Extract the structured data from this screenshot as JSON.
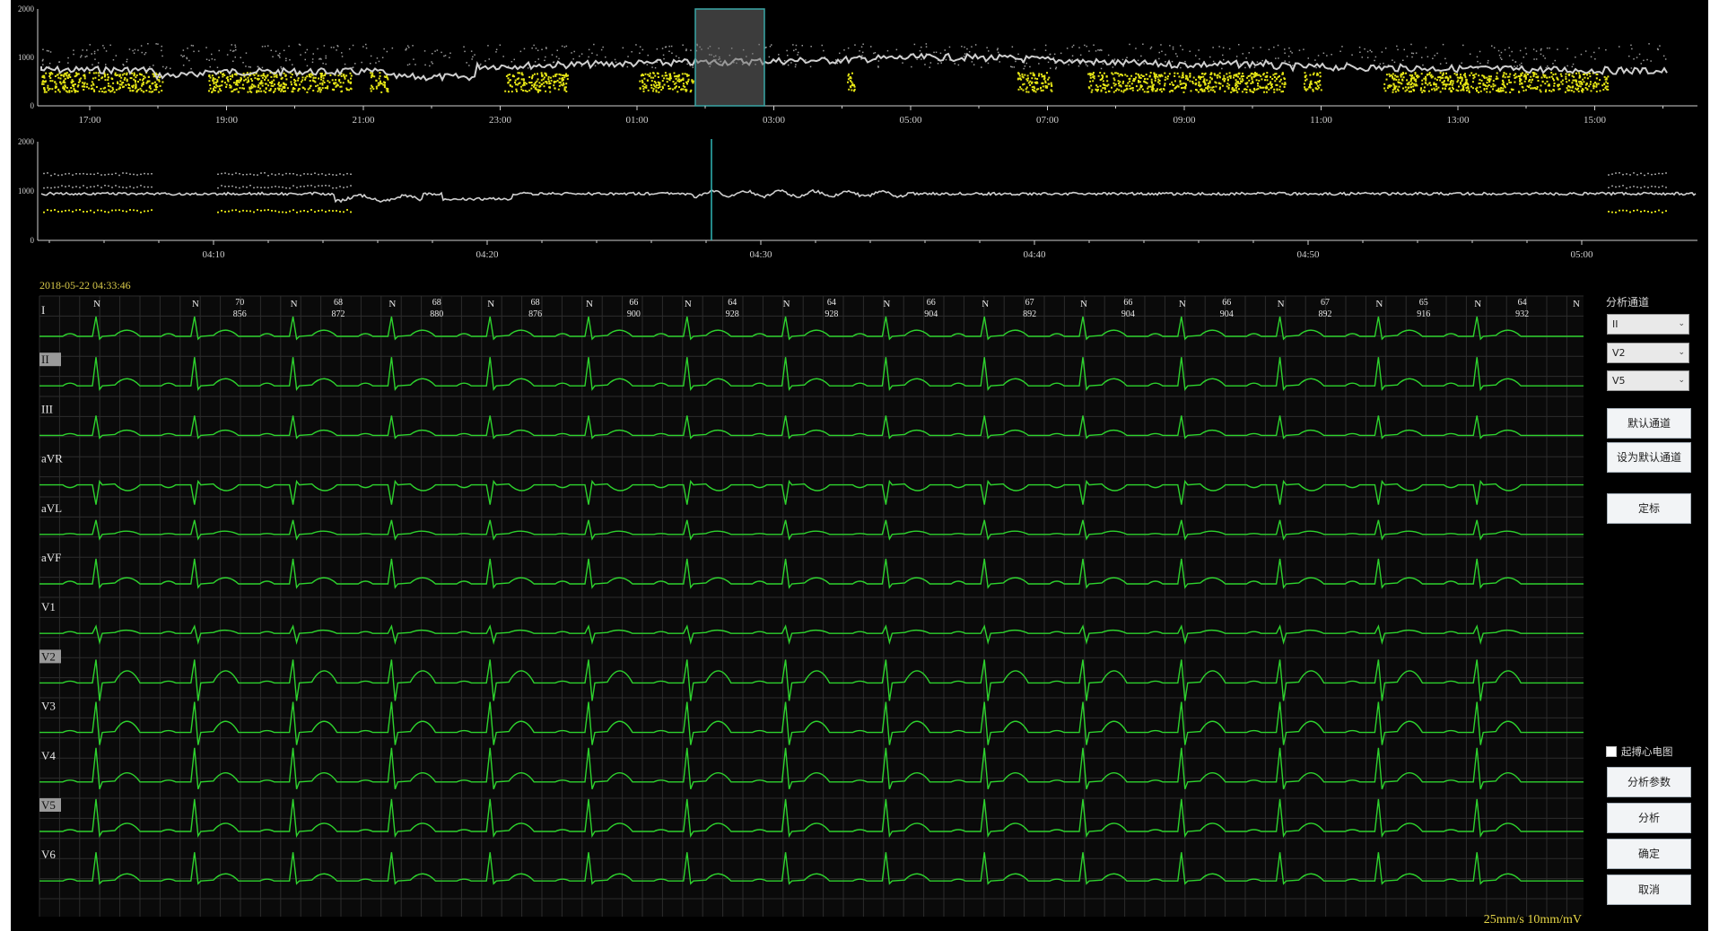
{
  "overview": {
    "y_axis": [
      "2000",
      "1000",
      "0"
    ],
    "time_ticks": [
      "17:00",
      "19:00",
      "21:00",
      "23:00",
      "01:00",
      "03:00",
      "05:00",
      "07:00",
      "09:00",
      "11:00",
      "13:00",
      "15:00"
    ]
  },
  "zoom": {
    "y_axis": [
      "2000",
      "1000",
      "0"
    ],
    "time_ticks": [
      "04:10",
      "04:20",
      "04:30",
      "04:40",
      "04:50",
      "05:00"
    ]
  },
  "ecg": {
    "timestamp": "2018-05-22 04:33:46",
    "leads": [
      "I",
      "II",
      "III",
      "aVR",
      "aVL",
      "aVF",
      "V1",
      "V2",
      "V3",
      "V4",
      "V5",
      "V6"
    ],
    "selected_leads": [
      "II",
      "V2",
      "V5"
    ],
    "beat_labels": [
      "N",
      "N",
      "N",
      "N",
      "N",
      "N",
      "N",
      "N",
      "N",
      "N",
      "N",
      "N",
      "N",
      "N",
      "N",
      "N"
    ],
    "hr_values": [
      "70",
      "68",
      "68",
      "68",
      "66",
      "64",
      "64",
      "66",
      "67",
      "66",
      "66",
      "67",
      "65",
      "64"
    ],
    "rr_values": [
      "856",
      "872",
      "880",
      "876",
      "900",
      "928",
      "928",
      "904",
      "892",
      "904",
      "904",
      "892",
      "916",
      "932"
    ],
    "scale_label": "25mm/s 10mm/mV",
    "colors": {
      "trace": "#2ed22e",
      "grid": "#2b2b2b",
      "timestamp": "#d8c94a",
      "scale": "#e8d84a"
    }
  },
  "side_panel": {
    "analysis_channel_label": "分析通道",
    "channel_selects": [
      "II",
      "V2",
      "V5"
    ],
    "default_channel_button": "默认通道",
    "set_default_button": "设为默认通道",
    "calibrate_button": "定标",
    "checkbox_label": "起搏心电图",
    "analysis_params_button": "分析参数",
    "analyze_button": "分析",
    "confirm_button": "确定",
    "cancel_button": "取消"
  },
  "colors": {
    "yellow_points": "#e6e615",
    "gray_trend": "#cfcfcf",
    "selection_border": "#3aa6a6"
  }
}
